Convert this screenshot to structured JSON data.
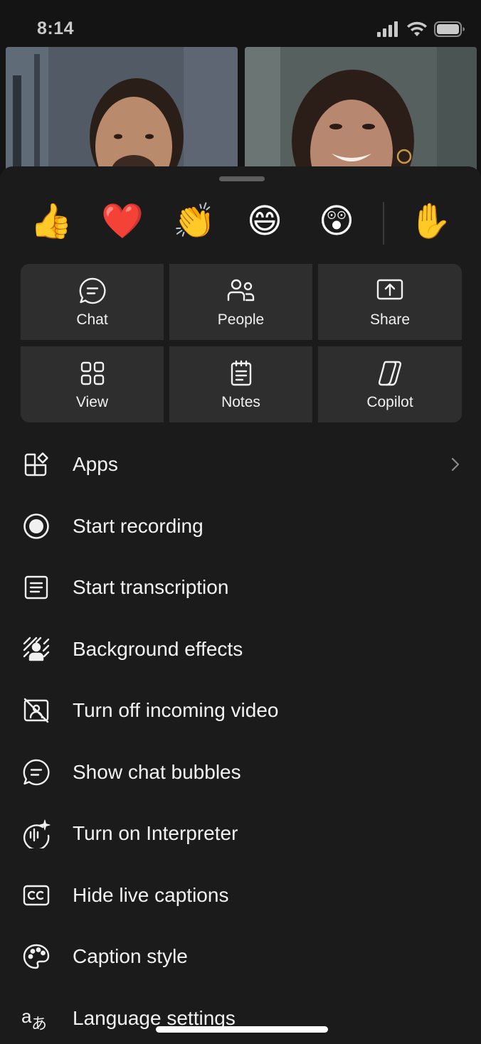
{
  "status": {
    "time": "8:14"
  },
  "reactions": [
    {
      "emoji": "👍",
      "name": "like"
    },
    {
      "emoji": "❤️",
      "name": "heart"
    },
    {
      "emoji": "👏",
      "name": "applause"
    },
    {
      "emoji": "😄",
      "name": "laugh"
    },
    {
      "emoji": "😲",
      "name": "surprised"
    },
    {
      "emoji": "✋",
      "name": "raise-hand"
    }
  ],
  "actions": {
    "chat": "Chat",
    "people": "People",
    "share": "Share",
    "view": "View",
    "notes": "Notes",
    "copilot": "Copilot"
  },
  "menu": {
    "apps": "Apps",
    "start_recording": "Start recording",
    "start_transcription": "Start transcription",
    "background_effects": "Background effects",
    "turn_off_incoming_video": "Turn off incoming video",
    "show_chat_bubbles": "Show chat bubbles",
    "turn_on_interpreter": "Turn on Interpreter",
    "hide_live_captions": "Hide live captions",
    "caption_style": "Caption style",
    "language_settings": "Language settings"
  }
}
